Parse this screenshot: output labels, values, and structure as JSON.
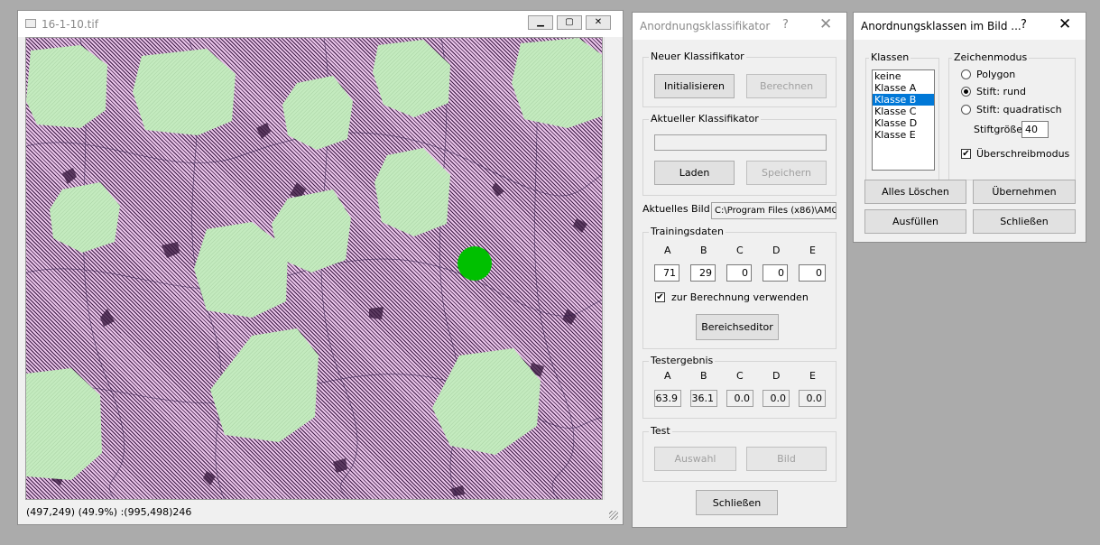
{
  "image_window": {
    "title": "16-1-10.tif",
    "status": "(497,249) (49.9%) :(995,498)246"
  },
  "classifier_window": {
    "title": "Anordnungsklassifikator",
    "help": "?",
    "close": "✕",
    "new_group": "Neuer Klassifikator",
    "init_button": "Initialisieren",
    "compute_button": "Berechnen",
    "current_group": "Aktueller Klassifikator",
    "current_value": "",
    "load_button": "Laden",
    "save_button": "Speichern",
    "image_label": "Aktuelles Bild",
    "image_path": "C:\\Program Files (x86)\\AMG",
    "training_group": "Trainingsdaten",
    "class_headers": [
      "A",
      "B",
      "C",
      "D",
      "E"
    ],
    "training_values": [
      "71",
      "29",
      "0",
      "0",
      "0"
    ],
    "use_checkbox": "zur Berechnung verwenden",
    "region_editor_button": "Bereichseditor",
    "test_result_group": "Testergebnis",
    "test_values": [
      "63.9",
      "36.1",
      "0.0",
      "0.0",
      "0.0"
    ],
    "test_group": "Test",
    "selection_button": "Auswahl",
    "image_button": "Bild",
    "close_button": "Schließen"
  },
  "classes_window": {
    "title": "Anordnungsklassen im Bild ...",
    "help": "?",
    "close": "✕",
    "classes_group": "Klassen",
    "classes": [
      "keine",
      "Klasse A",
      "Klasse B",
      "Klasse C",
      "Klasse D",
      "Klasse E"
    ],
    "selected_class": "Klasse B",
    "draw_mode_group": "Zeichenmodus",
    "mode_polygon": "Polygon",
    "mode_round": "Stift: rund",
    "mode_square": "Stift: quadratisch",
    "selected_mode": "Stift: rund",
    "pen_size_label": "Stiftgröße",
    "pen_size": "40",
    "overwrite_label": "Überschreibmodus",
    "delete_all_button": "Alles Löschen",
    "apply_button": "Übernehmen",
    "fill_button": "Ausfüllen",
    "close_button": "Schließen"
  },
  "colors": {
    "region_a": "#c4ebbf",
    "marker": "#00c000",
    "background": "#e8c3e8",
    "selection": "#0078d7"
  }
}
